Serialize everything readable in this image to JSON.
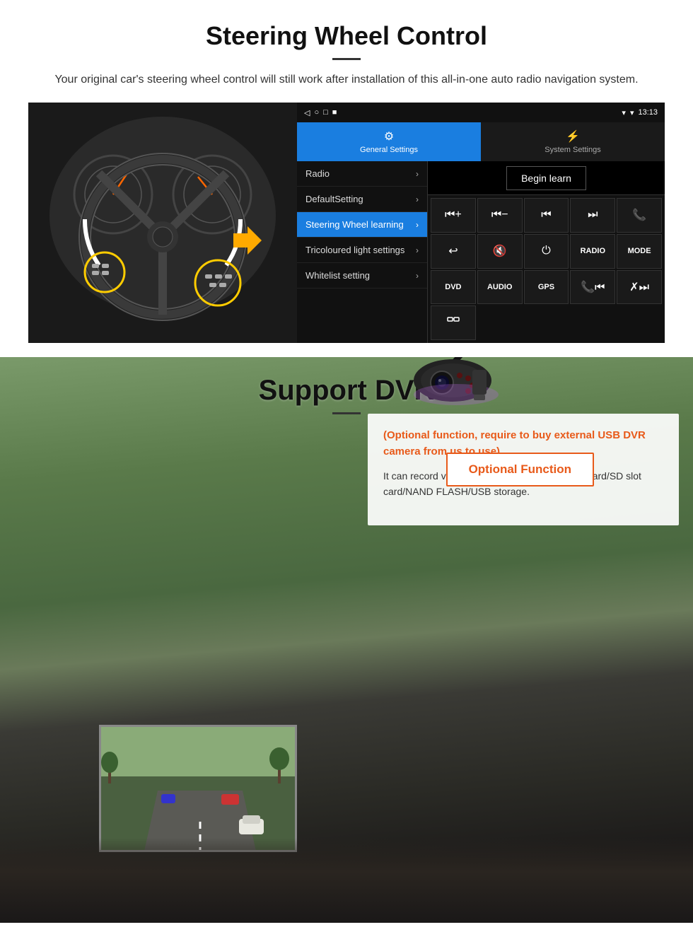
{
  "steering": {
    "title": "Steering Wheel Control",
    "description": "Your original car's steering wheel control will still work after installation of this all-in-one auto radio navigation system.",
    "status_bar": {
      "time": "13:13",
      "icons": [
        "◁",
        "○",
        "□",
        "■"
      ]
    },
    "tabs": [
      {
        "label": "General Settings",
        "icon": "⚙",
        "active": true
      },
      {
        "label": "System Settings",
        "icon": "⚡",
        "active": false
      }
    ],
    "menu_items": [
      {
        "label": "Radio",
        "active": false
      },
      {
        "label": "DefaultSetting",
        "active": false
      },
      {
        "label": "Steering Wheel learning",
        "active": true
      },
      {
        "label": "Tricoloured light settings",
        "active": false
      },
      {
        "label": "Whitelist setting",
        "active": false
      }
    ],
    "begin_learn": "Begin learn",
    "control_buttons": [
      "⏮+",
      "⏮−",
      "⏮⏮",
      "⏭⏭",
      "📞",
      "↩",
      "🔇×",
      "⏻",
      "RADIO",
      "MODE",
      "DVD",
      "AUDIO",
      "GPS",
      "📞⏮",
      "✗⏭"
    ]
  },
  "dvr": {
    "title": "Support DVR",
    "optional_text": "(Optional function, require to buy external USB DVR camera from us to use)",
    "description": "It can record video only to storage in GPS slot card/SD slot card/NAND FLASH/USB storage.",
    "optional_function_label": "Optional Function"
  }
}
